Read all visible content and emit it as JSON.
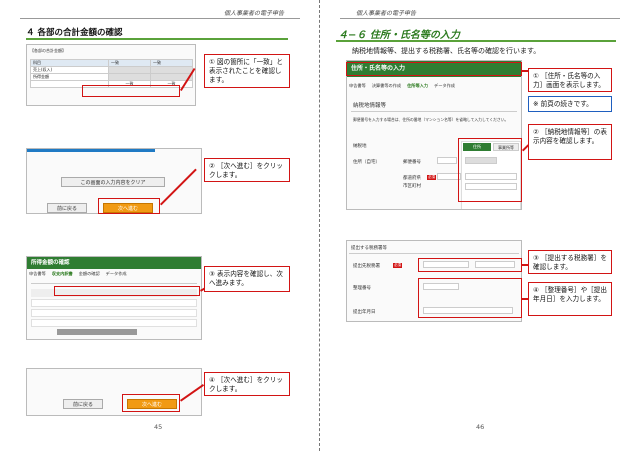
{
  "left_page": {
    "running_head": "個人事業者の電子申告",
    "section_title": "４ 各部の合計金額の確認",
    "page_number": "45",
    "callouts": [
      {
        "num": "①",
        "text": "図の箇所に「一致」と表示されたことを確認します。"
      },
      {
        "num": "②",
        "text": "［次へ進む］をクリックします。"
      },
      {
        "num": "③",
        "text": "表示内容を確認し、次へ進みます。"
      },
      {
        "num": "④",
        "text": "［次へ進む］をクリックします。"
      }
    ],
    "shot1": {
      "col1": "科目",
      "col2": "一致",
      "col3": "一致",
      "r1": "売上(収入)",
      "r2": "所得金額",
      "r3": "一致"
    },
    "shot2": {
      "clear_label": "この画面の入力内容をクリア",
      "back_label": "前に戻る",
      "next_label": "次へ進む"
    },
    "shot3": {
      "title": "所得金額の確認",
      "steps": [
        "申告書等",
        "収支内訳書",
        "金額の確認",
        "データ作成"
      ]
    },
    "shot4": {
      "back_label": "前に戻る",
      "next_label": "次へ進む"
    }
  },
  "right_page": {
    "running_head": "個人事業者の電子申告",
    "section_title": "４−６ 住所・氏名等の入力",
    "intro": "納税地情報等、提出する税務署、氏名等の確認を行います。",
    "page_number": "46",
    "callouts": [
      {
        "num": "①",
        "text": "［住所・氏名等の入力］画面を表示します。"
      },
      {
        "num": "※",
        "text": "前頁の続きです。"
      },
      {
        "num": "②",
        "text": "［納税地情報等］の表示内容を確認します。"
      },
      {
        "num": "③",
        "text": "［提出する税務署］を確認します。"
      },
      {
        "num": "④",
        "text": "［整理番号］や［提出年月日］を入力します。"
      }
    ],
    "shot1": {
      "header": "住所・氏名等の入力",
      "steps": [
        "申告書等",
        "決算書等の作成",
        "住所等入力",
        "データ作成"
      ],
      "subheading": "納税地情報等",
      "note": "郵便番号を入力する場合は、住所の番地（マンション名等）を省略して入力してください。",
      "row_label_1": "住所（自宅）",
      "row_label_2": "納税地",
      "postal_label": "郵便番号",
      "pref_label": "都道府県",
      "city_label": "市区町村",
      "tab_home": "住所",
      "tab_office": "事業所等",
      "required": "必須"
    },
    "shot2": {
      "heading": "提出する税務署等",
      "row1": "提出先税務署",
      "row2": "整理番号",
      "row3": "提出年月日",
      "required": "必須"
    }
  }
}
